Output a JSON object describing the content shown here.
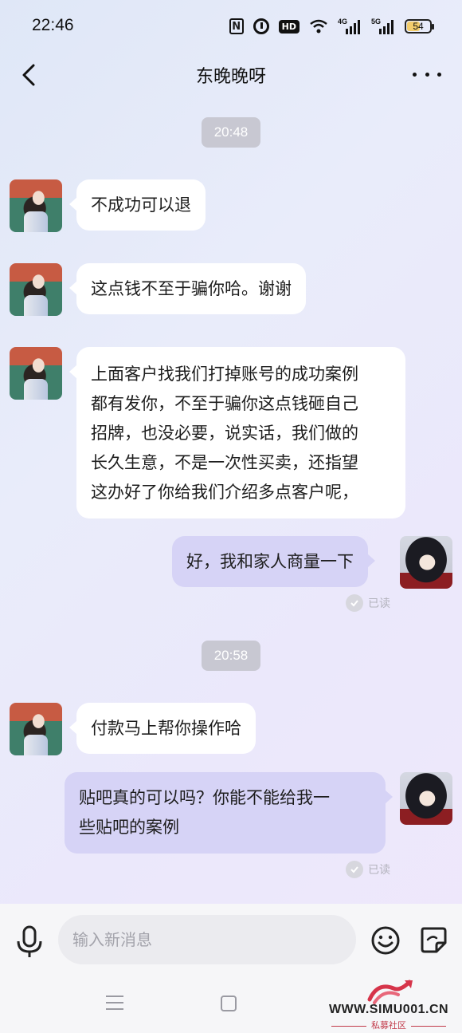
{
  "status_bar": {
    "time": "22:46",
    "network_4g": "4G",
    "network_5g": "5G",
    "hd_label": "HD",
    "battery_level": "54",
    "icons": [
      "nfc-icon",
      "alarm-icon",
      "hd-icon",
      "wifi-icon",
      "signal-4g-icon",
      "signal-5g-icon",
      "battery-icon"
    ]
  },
  "header": {
    "title": "东晚晚呀",
    "back_icon": "chevron-left-icon",
    "more_icon": "more-dots-icon"
  },
  "conversation": {
    "timestamps": [
      "20:48",
      "20:58"
    ],
    "messages": [
      {
        "side": "incoming",
        "text": "不成功可以退"
      },
      {
        "side": "incoming",
        "text": "这点钱不至于骗你哈。谢谢"
      },
      {
        "side": "incoming",
        "lines": [
          "上面客户找我们打掉账号的成功案例",
          "都有发你，不至于骗你这点钱砸自己",
          "招牌，也没必要，说实话，我们做的",
          "长久生意，不是一次性买卖，还指望",
          "这办好了你给我们介绍多点客户呢，"
        ]
      },
      {
        "side": "outgoing",
        "text": "好，我和家人商量一下",
        "status": "已读"
      },
      {
        "side": "incoming",
        "text": "付款马上帮你操作哈"
      },
      {
        "side": "outgoing",
        "lines": [
          "贴吧真的可以吗？你能不能给我一",
          "些贴吧的案例"
        ],
        "status": "已读"
      }
    ]
  },
  "input_bar": {
    "placeholder": "输入新消息",
    "value": "",
    "mic_icon": "microphone-icon",
    "emoji_icon": "smiley-icon",
    "sticker_icon": "sticker-icon"
  },
  "nav_bar": {
    "icons": [
      "menu-icon",
      "home-square-icon"
    ]
  },
  "watermark": {
    "url": "WWW.SIMU001.CN",
    "subtitle": "私募社区"
  },
  "colors": {
    "outgoing_bubble": "#d6d3f6",
    "incoming_bubble": "#ffffff",
    "time_chip": "#c8c8d2",
    "battery_fill": "#f3cd6c"
  }
}
